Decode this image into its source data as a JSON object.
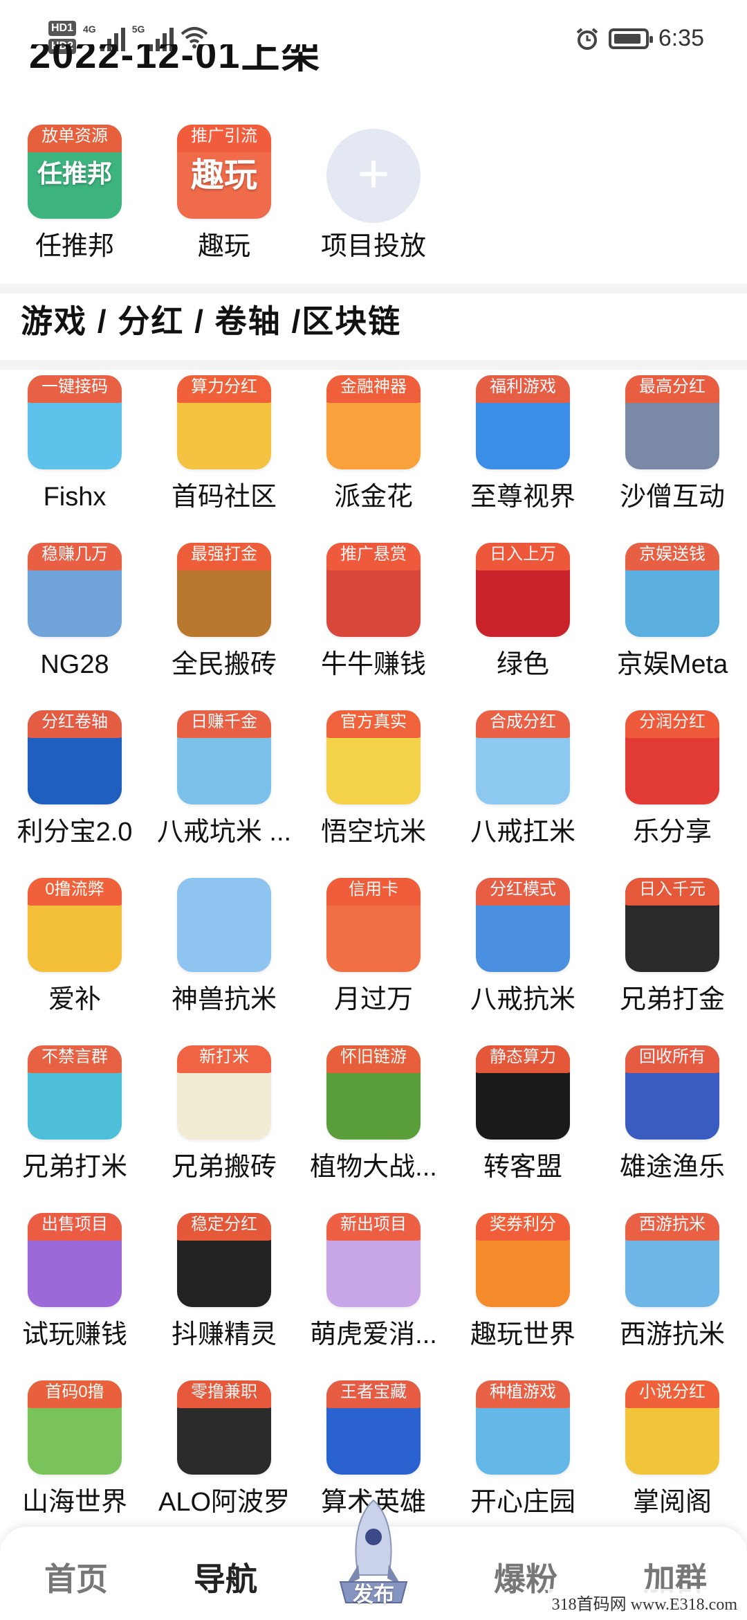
{
  "status_bar": {
    "hd1": "HD1",
    "hd2": "HD2",
    "net1": "4G",
    "net2": "5G",
    "time": "6:35"
  },
  "cut_heading": "2022-12-01上架",
  "featured": [
    {
      "name": "任推邦",
      "tag": "放单资源",
      "glyph": "任推邦",
      "color": "#3db37e"
    },
    {
      "name": "趣玩",
      "tag": "推广引流",
      "glyph": "趣玩",
      "color": "#f06b4a"
    }
  ],
  "add_project": {
    "label": "项目投放",
    "symbol": "+"
  },
  "section_title": "游戏 / 分红 / 卷轴 /区块链",
  "apps": [
    {
      "name": "Fishx",
      "tag": "一键接码",
      "color": "#5fc2ea"
    },
    {
      "name": "首码社区",
      "tag": "算力分红",
      "color": "#f3c240"
    },
    {
      "name": "派金花",
      "tag": "金融神器",
      "color": "#f9a23c"
    },
    {
      "name": "至尊视界",
      "tag": "福利游戏",
      "color": "#3a8ee6"
    },
    {
      "name": "沙僧互动",
      "tag": "最高分红",
      "color": "#7a8aa6"
    },
    {
      "name": "NG28",
      "tag": "稳赚几万",
      "color": "#6fa3d9"
    },
    {
      "name": "全民搬砖",
      "tag": "最强打金",
      "color": "#b8772d"
    },
    {
      "name": "牛牛赚钱",
      "tag": "推广悬赏",
      "color": "#d9463a"
    },
    {
      "name": "绿色",
      "tag": "日入上万",
      "color": "#c9222a"
    },
    {
      "name": "京娱Meta",
      "tag": "京娱送钱",
      "color": "#5aaee0"
    },
    {
      "name": "利分宝2.0",
      "tag": "分红卷轴",
      "color": "#1f5fbf"
    },
    {
      "name": "八戒坑米 ...",
      "tag": "日赚千金",
      "color": "#7bc1ea"
    },
    {
      "name": "悟空坑米",
      "tag": "官方真实",
      "color": "#f4d24a"
    },
    {
      "name": "八戒扛米",
      "tag": "合成分红",
      "color": "#8cc8ef"
    },
    {
      "name": "乐分享",
      "tag": "分润分红",
      "color": "#e23a34"
    },
    {
      "name": "爱补",
      "tag": "0撸流弊",
      "color": "#f4c03a"
    },
    {
      "name": "神兽抗米",
      "tag": "",
      "color": "#8fc4f0"
    },
    {
      "name": "月过万",
      "tag": "信用卡",
      "color": "#f06f44"
    },
    {
      "name": "八戒抗米",
      "tag": "分红模式",
      "color": "#4a8fe0"
    },
    {
      "name": "兄弟打金",
      "tag": "日入千元",
      "color": "#2a2a2a"
    },
    {
      "name": "兄弟打米",
      "tag": "不禁言群",
      "color": "#4dbfd9"
    },
    {
      "name": "兄弟搬砖",
      "tag": "新打米",
      "color": "#f3ecd5"
    },
    {
      "name": "植物大战...",
      "tag": "怀旧链游",
      "color": "#5a9e3a"
    },
    {
      "name": "转客盟",
      "tag": "静态算力",
      "color": "#1a1a1a"
    },
    {
      "name": "雄途渔乐",
      "tag": "回收所有",
      "color": "#3a5cc0"
    },
    {
      "name": "试玩赚钱",
      "tag": "出售项目",
      "color": "#9b6ad8"
    },
    {
      "name": "抖赚精灵",
      "tag": "稳定分红",
      "color": "#222222"
    },
    {
      "name": "萌虎爱消...",
      "tag": "新出项目",
      "color": "#c8a6e8"
    },
    {
      "name": "趣玩世界",
      "tag": "奖券利分",
      "color": "#f58a2a"
    },
    {
      "name": "西游抗米",
      "tag": "西游抗米",
      "color": "#6fb6e8"
    },
    {
      "name": "山海世界",
      "tag": "首码0撸",
      "color": "#7ac25a"
    },
    {
      "name": "ALO阿波罗",
      "tag": "零撸兼职",
      "color": "#2b2b2b"
    },
    {
      "name": "算术英雄",
      "tag": "王者宝藏",
      "color": "#2a62d0"
    },
    {
      "name": "开心庄园",
      "tag": "种植游戏",
      "color": "#63b8e8"
    },
    {
      "name": "掌阅阁",
      "tag": "小说分红",
      "color": "#f2c43a"
    }
  ],
  "nav": {
    "home": "首页",
    "guide": "导航",
    "publish": "发布",
    "fans": "爆粉",
    "group": "加群"
  },
  "watermark": "318首码网 www.E318.com"
}
